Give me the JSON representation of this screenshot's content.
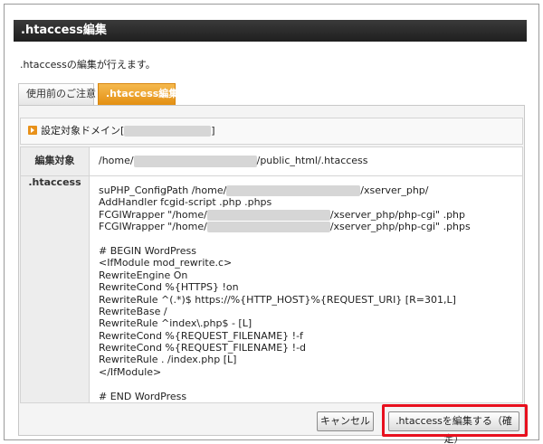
{
  "header": {
    "title": ".htaccess編集"
  },
  "description": ".htaccessの編集が行えます。",
  "tabs": [
    {
      "label": "使用前のご注意",
      "active": false
    },
    {
      "label": ".htaccess編集",
      "active": true
    }
  ],
  "domain": {
    "label": "設定対象ドメイン[",
    "close": "]"
  },
  "table": {
    "rows": [
      {
        "header": "編集対象",
        "path_prefix": "/home/",
        "path_suffix": "/public_html/.htaccess"
      },
      {
        "header": ".htaccess"
      }
    ]
  },
  "code": {
    "l1a": "suPHP_ConfigPath /home/",
    "l1b": "/xserver_php/",
    "l2": "AddHandler fcgid-script .php .phps",
    "l3a": "FCGIWrapper \"/home/",
    "l3b": "/xserver_php/php-cgi\" .php",
    "l4a": "FCGIWrapper \"/home/",
    "l4b": "/xserver_php/php-cgi\" .phps",
    "l5": "# BEGIN WordPress",
    "l6": "<IfModule mod_rewrite.c>",
    "l7": "RewriteEngine On",
    "l8": "RewriteCond %{HTTPS} !on",
    "l9": "RewriteRule ^(.*)$ https://%{HTTP_HOST}%{REQUEST_URI} [R=301,L]",
    "l10": "RewriteBase /",
    "l11": "RewriteRule ^index\\.php$ - [L]",
    "l12": "RewriteCond %{REQUEST_FILENAME} !-f",
    "l13": "RewriteCond %{REQUEST_FILENAME} !-d",
    "l14": "RewriteRule . /index.php [L]",
    "l15": "</IfModule>",
    "l16": "# END WordPress"
  },
  "buttons": {
    "cancel": "キャンセル",
    "confirm": ".htaccessを編集する（確定）"
  },
  "colors": {
    "highlight": "#e8101e",
    "tab_active": "#e38f12",
    "title_bg": "#1f1f1f"
  }
}
